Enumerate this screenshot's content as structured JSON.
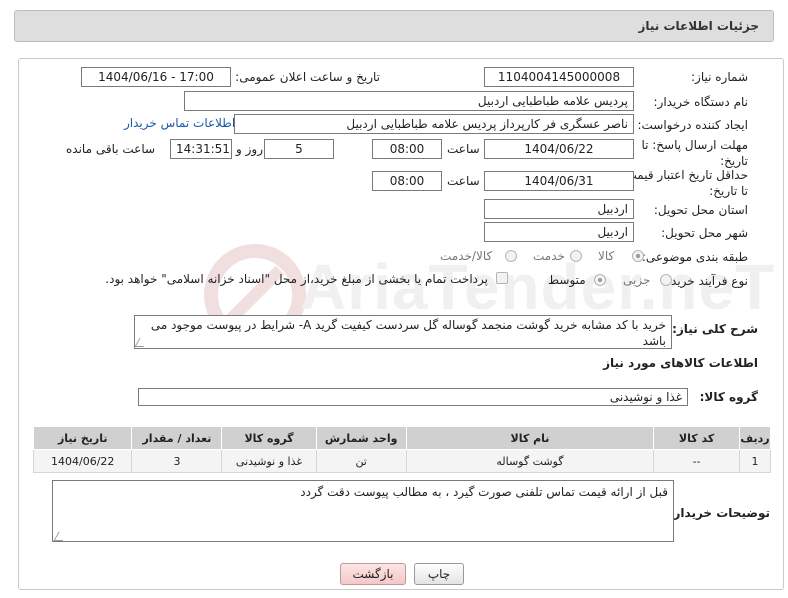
{
  "header": {
    "title": "جزئیات اطلاعات نیاز"
  },
  "watermark": {
    "text": "AriaTender.neT"
  },
  "form": {
    "need_number": {
      "label": "شماره نیاز:",
      "value": "1104004145000008"
    },
    "announce_datetime": {
      "label": "تاریخ و ساعت اعلان عمومی:",
      "value": "1404/06/16 - 17:00"
    },
    "buyer_org": {
      "label": "نام دستگاه خریدار:",
      "value": "پردیس علامه طباطبایی اردبیل"
    },
    "requester": {
      "label": "ایجاد کننده درخواست:",
      "value": "ناصر عسگری فر کارپرداز پردیس علامه طباطبایی اردبیل",
      "contact_link": "اطلاعات تماس خریدار"
    },
    "reply_deadline": {
      "label": "مهلت ارسال پاسخ: تا تاریخ:",
      "date": "1404/06/22",
      "time_label": "ساعت",
      "time": "08:00",
      "days": "5",
      "days_label": "روز و",
      "remaining": "14:31:51",
      "remaining_label": "ساعت باقی مانده"
    },
    "price_validity": {
      "label": "حداقل تاریخ اعتبار قیمت: تا تاریخ:",
      "date": "1404/06/31",
      "time_label": "ساعت",
      "time": "08:00"
    },
    "delivery_province": {
      "label": "استان محل تحویل:",
      "value": "اردبیل"
    },
    "delivery_city": {
      "label": "شهر محل تحویل:",
      "value": "اردبیل"
    },
    "category": {
      "label": "طبقه بندی موضوعی:",
      "options": [
        "کالا",
        "خدمت",
        "کالا/خدمت"
      ],
      "selected": "کالا"
    },
    "purchase_process": {
      "label": "نوع فرآیند خرید :",
      "options": [
        "جزیی",
        "متوسط"
      ],
      "selected": "متوسط",
      "note": "پرداخت تمام یا بخشی از مبلغ خرید،از محل \"اسناد خزانه اسلامی\" خواهد بود."
    },
    "general_description": {
      "label": "شرح کلی نیاز:",
      "value": "خرید با کد مشابه خرید گوشت منجمد گوساله گل سردست کیفیت گرید A- شرایط در پیوست موجود می باشد"
    }
  },
  "goods": {
    "section_title": "اطلاعات کالاهای مورد نیاز",
    "group_label": "گروه کالا:",
    "group_value": "غذا و نوشیدنی",
    "table": {
      "headers": [
        "ردیف",
        "کد کالا",
        "نام کالا",
        "واحد شمارش",
        "گروه کالا",
        "تعداد / مقدار",
        "تاریخ نیاز"
      ],
      "rows": [
        [
          "1",
          "--",
          "گوشت گوساله",
          "تن",
          "غذا و نوشیدنی",
          "3",
          "1404/06/22"
        ]
      ]
    }
  },
  "buyer_notes": {
    "label": "توضیحات خریدار:",
    "value": "قبل از ارائه قیمت تماس تلفنی صورت گیرد ، به مطالب پیوست دقت گردد"
  },
  "buttons": {
    "print": "چاپ",
    "back": "بازگشت"
  }
}
